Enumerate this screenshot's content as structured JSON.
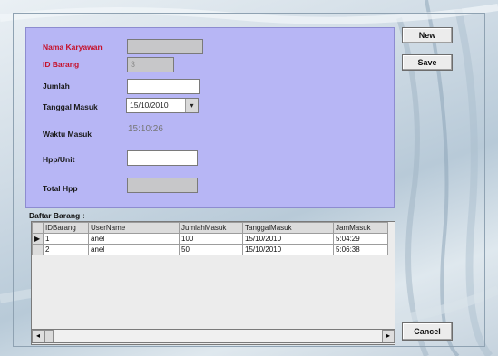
{
  "form": {
    "nama_karyawan_label": "Nama Karyawan",
    "nama_karyawan_value": "",
    "id_barang_label": "ID Barang",
    "id_barang_value": "3",
    "jumlah_label": "Jumlah",
    "jumlah_value": "",
    "tanggal_masuk_label": "Tanggal Masuk",
    "tanggal_masuk_value": "15/10/2010",
    "waktu_masuk_label": "Waktu Masuk",
    "waktu_masuk_value": "15:10:26",
    "hpp_unit_label": "Hpp/Unit",
    "hpp_unit_value": "",
    "total_hpp_label": "Total Hpp",
    "total_hpp_value": ""
  },
  "buttons": {
    "new_label": "New",
    "save_label": "Save",
    "cancel_label": "Cancel"
  },
  "grid": {
    "title": "Daftar Barang :",
    "columns": [
      "IDBarang",
      "UserName",
      "JumlahMasuk",
      "TanggalMasuk",
      "JamMasuk"
    ],
    "rows": [
      {
        "selected": true,
        "cells": [
          "1",
          "anel",
          "100",
          "15/10/2010",
          "5:04:29"
        ]
      },
      {
        "selected": false,
        "cells": [
          "2",
          "anel",
          "50",
          "15/10/2010",
          "5:06:38"
        ]
      }
    ],
    "row_indicator": "▶",
    "scroll_left": "◂",
    "scroll_right": "▸"
  },
  "icons": {
    "dropdown": "chevron-down-icon"
  }
}
